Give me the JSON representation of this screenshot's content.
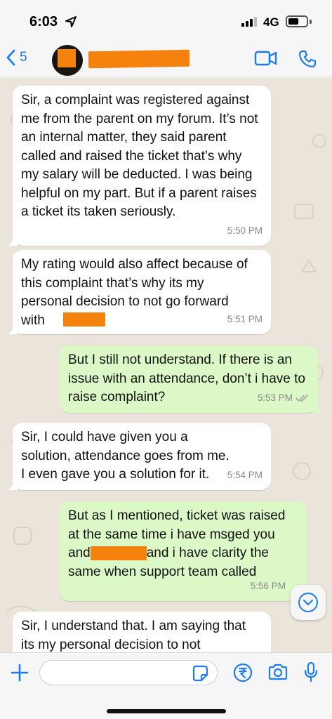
{
  "status_bar": {
    "time": "6:03",
    "network": "4G"
  },
  "header": {
    "back_count": "5"
  },
  "messages": [
    {
      "direction": "in",
      "text": "Sir, a complaint was registered against me from the parent on my forum. It’s not an internal matter, they said parent called and raised the ticket that’s why my salary will be deducted. I was being helpful on my part. But if a parent raises a ticket its taken seriously.",
      "time": "5:50 PM"
    },
    {
      "direction": "in",
      "text": "My rating would also affect because of this complaint that’s why its my personal decision to not go forward with",
      "time": "5:51 PM"
    },
    {
      "direction": "out",
      "text": "But I still not understand. If there is an issue with an attendance, don’t i have to raise complaint?",
      "time": "5:53 PM"
    },
    {
      "direction": "in",
      "text": "Sir, I could have given you a solution, attendance goes from me. I even gave you a solution for it.",
      "time": "5:54 PM"
    },
    {
      "direction": "out",
      "text_before": "But as I mentioned, ticket was raised at the same time i have msged you and",
      "text_after": "and i have clarity the same when support team called",
      "time": "5:56 PM"
    },
    {
      "direction": "in",
      "text": "Sir, I understand that. I am saying that its my personal decision to not"
    }
  ],
  "composer": {
    "placeholder": ""
  },
  "colors": {
    "accent": "#1d7cf2",
    "outgoing": "#dcf8c6",
    "incoming": "#ffffff",
    "chat_bg": "#ebe4da",
    "redaction": "#f5820d"
  }
}
